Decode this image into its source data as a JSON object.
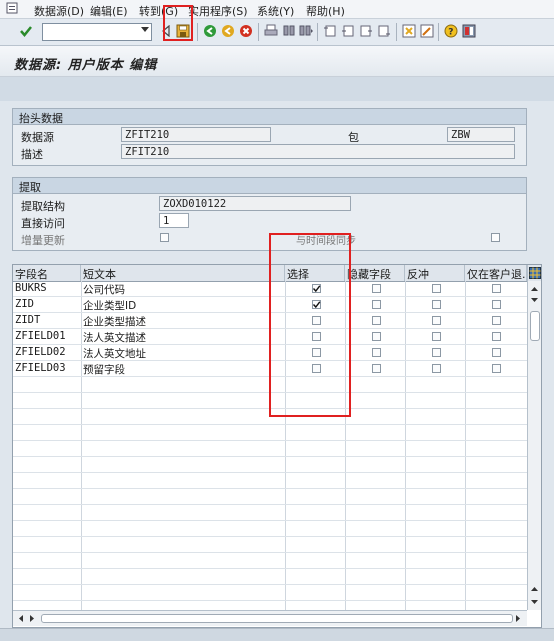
{
  "menu": {
    "items": [
      "数据源(D)",
      "编辑(E)",
      "转到(G)",
      "实用程序(S)",
      "系统(Y)",
      "帮助(H)"
    ]
  },
  "toolbar": {
    "command_value": "",
    "icons": [
      "enter-icon",
      "back-icon",
      "save-icon",
      "exit-icon",
      "cancel-icon",
      "print-icon",
      "find-icon",
      "find-next-icon",
      "first-page-icon",
      "prev-page-icon",
      "next-page-icon",
      "last-page-icon",
      "create-session-icon",
      "shortcut-icon",
      "help-icon",
      "layout-icon"
    ]
  },
  "page": {
    "title": "数据源: 用户版本 编辑"
  },
  "header_group": {
    "title": "抬头数据",
    "datasource_label": "数据源",
    "datasource_value": "ZFIT210",
    "package_label": "包",
    "package_value": "ZBW",
    "description_label": "描述",
    "description_value": "ZFIT210"
  },
  "extract_group": {
    "title": "提取",
    "structure_label": "提取结构",
    "structure_value": "ZOXD010122",
    "direct_access_label": "直接访问",
    "direct_access_value": "1",
    "delta_label": "增量更新",
    "sync_label": "与时间段同步"
  },
  "grid": {
    "columns": [
      "字段名",
      "短文本",
      "选择",
      "隐藏字段",
      "反冲",
      "仅在客户退..."
    ],
    "rows": [
      {
        "field": "BUKRS",
        "text": "公司代码",
        "select": true
      },
      {
        "field": "ZID",
        "text": "企业类型ID",
        "select": true
      },
      {
        "field": "ZIDT",
        "text": "企业类型描述",
        "select": false
      },
      {
        "field": "ZFIELD01",
        "text": "法人英文描述",
        "select": false
      },
      {
        "field": "ZFIELD02",
        "text": "法人英文地址",
        "select": false
      },
      {
        "field": "ZFIELD03",
        "text": "预留字段",
        "select": false
      }
    ]
  },
  "colors": {
    "annotation": "#e02020"
  }
}
